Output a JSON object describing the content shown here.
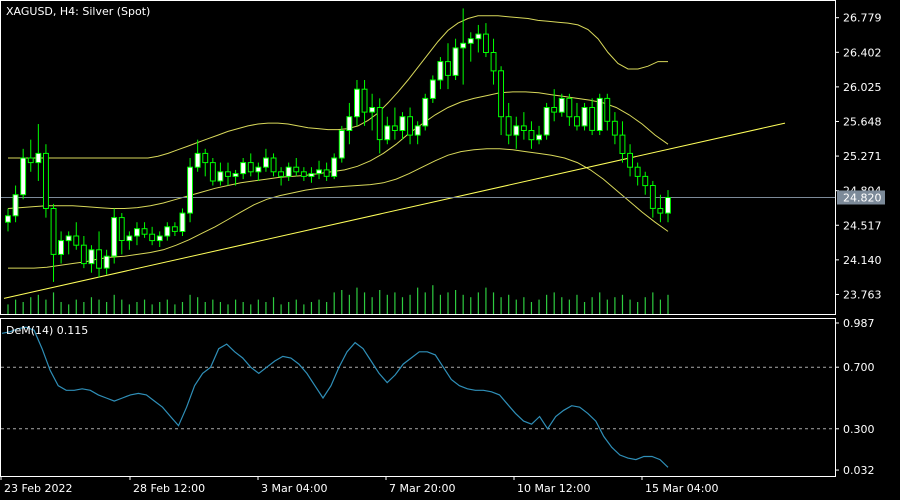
{
  "colors": {
    "background": "#000000",
    "frame": "#ffffff",
    "text": "#ffffff",
    "bull_candle": "#ffffff",
    "candle_wick": "#00ff00",
    "bands": "#d8d85a",
    "trendline": "#ffff5a",
    "volume": "#2ecc40",
    "dem_line": "#2f8fb8",
    "current_price_line": "#7c8a99",
    "current_price_label_bg": "#7c8a99",
    "dashed_level": "#aaaaaa"
  },
  "header": {
    "symbol_label": "XAGUSD, H4:  Silver (Spot)"
  },
  "chart_data": [
    {
      "type": "candlestick",
      "title": "XAGUSD, H4:  Silver (Spot)",
      "y_ticks": [
        "26.779",
        "26.402",
        "26.025",
        "25.648",
        "25.271",
        "24.894",
        "24.517",
        "24.140",
        "23.763"
      ],
      "ylim": [
        23.55,
        26.95
      ],
      "x_ticks": [
        "23 Feb 2022",
        "28 Feb 12:00",
        "3 Mar 04:00",
        "7 Mar 20:00",
        "10 Mar 12:00",
        "15 Mar 04:00"
      ],
      "current_price": "24.820",
      "indicators": [
        "Bollinger Bands",
        "Trendline",
        "Volume"
      ],
      "candles": [
        {
          "o": 24.55,
          "h": 24.7,
          "l": 24.45,
          "c": 24.62
        },
        {
          "o": 24.62,
          "h": 24.95,
          "l": 24.55,
          "c": 24.85
        },
        {
          "o": 24.85,
          "h": 25.35,
          "l": 24.8,
          "c": 25.25
        },
        {
          "o": 25.25,
          "h": 25.45,
          "l": 25.1,
          "c": 25.2
        },
        {
          "o": 25.2,
          "h": 25.62,
          "l": 25.0,
          "c": 25.3
        },
        {
          "o": 25.3,
          "h": 25.4,
          "l": 24.6,
          "c": 24.7
        },
        {
          "o": 24.7,
          "h": 24.75,
          "l": 23.9,
          "c": 24.2
        },
        {
          "o": 24.2,
          "h": 24.45,
          "l": 24.1,
          "c": 24.35
        },
        {
          "o": 24.35,
          "h": 24.45,
          "l": 24.2,
          "c": 24.4
        },
        {
          "o": 24.4,
          "h": 24.55,
          "l": 24.25,
          "c": 24.3
        },
        {
          "o": 24.3,
          "h": 24.4,
          "l": 24.05,
          "c": 24.1
        },
        {
          "o": 24.1,
          "h": 24.3,
          "l": 24.0,
          "c": 24.25
        },
        {
          "o": 24.25,
          "h": 24.45,
          "l": 23.95,
          "c": 24.05
        },
        {
          "o": 24.05,
          "h": 24.25,
          "l": 23.98,
          "c": 24.18
        },
        {
          "o": 24.18,
          "h": 24.7,
          "l": 24.1,
          "c": 24.6
        },
        {
          "o": 24.6,
          "h": 24.65,
          "l": 24.2,
          "c": 24.35
        },
        {
          "o": 24.35,
          "h": 24.45,
          "l": 24.25,
          "c": 24.4
        },
        {
          "o": 24.4,
          "h": 24.55,
          "l": 24.3,
          "c": 24.48
        },
        {
          "o": 24.48,
          "h": 24.55,
          "l": 24.38,
          "c": 24.42
        },
        {
          "o": 24.42,
          "h": 24.5,
          "l": 24.3,
          "c": 24.35
        },
        {
          "o": 24.35,
          "h": 24.45,
          "l": 24.28,
          "c": 24.4
        },
        {
          "o": 24.4,
          "h": 24.55,
          "l": 24.35,
          "c": 24.5
        },
        {
          "o": 24.5,
          "h": 24.55,
          "l": 24.4,
          "c": 24.45
        },
        {
          "o": 24.45,
          "h": 24.7,
          "l": 24.4,
          "c": 24.65
        },
        {
          "o": 24.65,
          "h": 25.25,
          "l": 24.55,
          "c": 25.15
        },
        {
          "o": 25.15,
          "h": 25.45,
          "l": 25.1,
          "c": 25.3
        },
        {
          "o": 25.3,
          "h": 25.35,
          "l": 25.05,
          "c": 25.2
        },
        {
          "o": 25.2,
          "h": 25.25,
          "l": 24.95,
          "c": 25.0
        },
        {
          "o": 25.0,
          "h": 25.2,
          "l": 24.95,
          "c": 25.1
        },
        {
          "o": 25.1,
          "h": 25.2,
          "l": 24.95,
          "c": 25.05
        },
        {
          "o": 25.05,
          "h": 25.12,
          "l": 24.95,
          "c": 25.08
        },
        {
          "o": 25.08,
          "h": 25.25,
          "l": 25.02,
          "c": 25.2
        },
        {
          "o": 25.2,
          "h": 25.3,
          "l": 25.05,
          "c": 25.1
        },
        {
          "o": 25.1,
          "h": 25.2,
          "l": 25.0,
          "c": 25.15
        },
        {
          "o": 25.15,
          "h": 25.35,
          "l": 25.1,
          "c": 25.25
        },
        {
          "o": 25.25,
          "h": 25.3,
          "l": 25.05,
          "c": 25.1
        },
        {
          "o": 25.1,
          "h": 25.15,
          "l": 24.95,
          "c": 25.05
        },
        {
          "o": 25.05,
          "h": 25.2,
          "l": 25.0,
          "c": 25.15
        },
        {
          "o": 25.15,
          "h": 25.25,
          "l": 25.05,
          "c": 25.1
        },
        {
          "o": 25.1,
          "h": 25.15,
          "l": 25.0,
          "c": 25.05
        },
        {
          "o": 25.05,
          "h": 25.15,
          "l": 24.98,
          "c": 25.08
        },
        {
          "o": 25.08,
          "h": 25.22,
          "l": 25.02,
          "c": 25.12
        },
        {
          "o": 25.12,
          "h": 25.2,
          "l": 25.0,
          "c": 25.05
        },
        {
          "o": 25.05,
          "h": 25.3,
          "l": 25.02,
          "c": 25.25
        },
        {
          "o": 25.25,
          "h": 25.6,
          "l": 25.2,
          "c": 25.55
        },
        {
          "o": 25.55,
          "h": 25.85,
          "l": 25.4,
          "c": 25.7
        },
        {
          "o": 25.7,
          "h": 26.1,
          "l": 25.6,
          "c": 26.0
        },
        {
          "o": 26.0,
          "h": 26.1,
          "l": 25.6,
          "c": 25.75
        },
        {
          "o": 25.75,
          "h": 25.95,
          "l": 25.55,
          "c": 25.8
        },
        {
          "o": 25.8,
          "h": 25.9,
          "l": 25.3,
          "c": 25.45
        },
        {
          "o": 25.45,
          "h": 25.7,
          "l": 25.4,
          "c": 25.6
        },
        {
          "o": 25.6,
          "h": 25.8,
          "l": 25.45,
          "c": 25.55
        },
        {
          "o": 25.55,
          "h": 25.75,
          "l": 25.45,
          "c": 25.7
        },
        {
          "o": 25.7,
          "h": 25.8,
          "l": 25.4,
          "c": 25.5
        },
        {
          "o": 25.5,
          "h": 25.65,
          "l": 25.4,
          "c": 25.6
        },
        {
          "o": 25.6,
          "h": 25.95,
          "l": 25.55,
          "c": 25.9
        },
        {
          "o": 25.9,
          "h": 26.15,
          "l": 25.85,
          "c": 26.1
        },
        {
          "o": 26.1,
          "h": 26.35,
          "l": 26.0,
          "c": 26.3
        },
        {
          "o": 26.3,
          "h": 26.5,
          "l": 26.0,
          "c": 26.15
        },
        {
          "o": 26.15,
          "h": 26.55,
          "l": 26.1,
          "c": 26.45
        },
        {
          "o": 26.45,
          "h": 26.88,
          "l": 26.05,
          "c": 26.5
        },
        {
          "o": 26.5,
          "h": 26.62,
          "l": 26.3,
          "c": 26.55
        },
        {
          "o": 26.55,
          "h": 26.7,
          "l": 26.4,
          "c": 26.6
        },
        {
          "o": 26.6,
          "h": 26.72,
          "l": 26.35,
          "c": 26.4
        },
        {
          "o": 26.4,
          "h": 26.55,
          "l": 26.05,
          "c": 26.2
        },
        {
          "o": 26.2,
          "h": 26.25,
          "l": 25.5,
          "c": 25.7
        },
        {
          "o": 25.7,
          "h": 25.85,
          "l": 25.4,
          "c": 25.5
        },
        {
          "o": 25.5,
          "h": 25.7,
          "l": 25.35,
          "c": 25.6
        },
        {
          "o": 25.6,
          "h": 25.75,
          "l": 25.45,
          "c": 25.55
        },
        {
          "o": 25.55,
          "h": 25.65,
          "l": 25.35,
          "c": 25.45
        },
        {
          "o": 25.45,
          "h": 25.6,
          "l": 25.4,
          "c": 25.5
        },
        {
          "o": 25.5,
          "h": 25.85,
          "l": 25.45,
          "c": 25.8
        },
        {
          "o": 25.8,
          "h": 26.0,
          "l": 25.65,
          "c": 25.75
        },
        {
          "o": 25.75,
          "h": 25.95,
          "l": 25.7,
          "c": 25.9
        },
        {
          "o": 25.9,
          "h": 25.95,
          "l": 25.6,
          "c": 25.7
        },
        {
          "o": 25.7,
          "h": 25.85,
          "l": 25.55,
          "c": 25.6
        },
        {
          "o": 25.6,
          "h": 25.85,
          "l": 25.55,
          "c": 25.8
        },
        {
          "o": 25.8,
          "h": 25.9,
          "l": 25.5,
          "c": 25.55
        },
        {
          "o": 25.55,
          "h": 25.95,
          "l": 25.5,
          "c": 25.9
        },
        {
          "o": 25.9,
          "h": 25.95,
          "l": 25.55,
          "c": 25.65
        },
        {
          "o": 25.65,
          "h": 25.75,
          "l": 25.4,
          "c": 25.5
        },
        {
          "o": 25.5,
          "h": 25.65,
          "l": 25.2,
          "c": 25.3
        },
        {
          "o": 25.3,
          "h": 25.4,
          "l": 25.05,
          "c": 25.15
        },
        {
          "o": 25.15,
          "h": 25.2,
          "l": 24.95,
          "c": 25.05
        },
        {
          "o": 25.05,
          "h": 25.1,
          "l": 24.85,
          "c": 24.95
        },
        {
          "o": 24.95,
          "h": 25.0,
          "l": 24.6,
          "c": 24.7
        },
        {
          "o": 24.7,
          "h": 24.85,
          "l": 24.55,
          "c": 24.65
        },
        {
          "o": 24.65,
          "h": 24.9,
          "l": 24.55,
          "c": 24.82
        }
      ],
      "volume": [
        4,
        6,
        5,
        7,
        8,
        6,
        9,
        5,
        4,
        6,
        5,
        7,
        6,
        5,
        8,
        6,
        4,
        5,
        6,
        4,
        5,
        6,
        4,
        5,
        8,
        7,
        5,
        6,
        5,
        4,
        6,
        5,
        4,
        6,
        5,
        7,
        4,
        5,
        6,
        4,
        5,
        6,
        5,
        9,
        10,
        8,
        11,
        9,
        7,
        10,
        8,
        9,
        7,
        8,
        11,
        9,
        12,
        8,
        9,
        10,
        8,
        7,
        9,
        11,
        9,
        7,
        8,
        6,
        7,
        5,
        6,
        8,
        9,
        7,
        6,
        8,
        5,
        7,
        9,
        6,
        7,
        8,
        6,
        5,
        7,
        9,
        6,
        8,
        5
      ],
      "bands": {
        "upper": [
          25.25,
          25.25,
          25.25,
          25.25,
          25.25,
          25.25,
          25.25,
          25.25,
          25.25,
          25.25,
          25.25,
          25.25,
          25.25,
          25.25,
          25.25,
          25.27,
          25.3,
          25.34,
          25.38,
          25.42,
          25.46,
          25.5,
          25.54,
          25.57,
          25.6,
          25.62,
          25.63,
          25.63,
          25.62,
          25.6,
          25.58,
          25.57,
          25.56,
          25.56,
          25.57,
          25.6,
          25.66,
          25.74,
          25.85,
          25.97,
          26.1,
          26.24,
          26.38,
          26.52,
          26.64,
          26.72,
          26.77,
          26.8,
          26.8,
          26.8,
          26.79,
          26.78,
          26.77,
          26.75,
          26.74,
          26.73,
          26.72,
          26.7,
          26.65,
          26.55,
          26.4,
          26.28,
          26.22,
          26.22,
          26.25,
          26.3,
          26.3
        ],
        "middle": [
          24.7,
          24.71,
          24.72,
          24.73,
          24.73,
          24.73,
          24.72,
          24.71,
          24.7,
          24.7,
          24.71,
          24.73,
          24.76,
          24.8,
          24.84,
          24.88,
          24.92,
          24.95,
          24.98,
          25.0,
          25.02,
          25.04,
          25.05,
          25.06,
          25.08,
          25.1,
          25.12,
          25.16,
          25.22,
          25.3,
          25.4,
          25.52,
          25.62,
          25.72,
          25.8,
          25.86,
          25.9,
          25.93,
          25.96,
          25.97,
          25.97,
          25.96,
          25.94,
          25.92,
          25.9,
          25.88,
          25.85,
          25.8,
          25.72,
          25.62,
          25.5,
          25.4
        ],
        "lower": [
          24.05,
          24.05,
          24.05,
          24.06,
          24.08,
          24.1,
          24.12,
          24.15,
          24.17,
          24.18,
          24.2,
          24.22,
          24.25,
          24.3,
          24.36,
          24.43,
          24.5,
          24.58,
          24.66,
          24.74,
          24.8,
          24.84,
          24.87,
          24.9,
          24.92,
          24.93,
          24.94,
          24.95,
          24.96,
          24.98,
          25.02,
          25.08,
          25.15,
          25.22,
          25.28,
          25.32,
          25.34,
          25.35,
          25.35,
          25.34,
          25.32,
          25.3,
          25.28,
          25.25,
          25.2,
          25.12,
          25.02,
          24.9,
          24.78,
          24.66,
          24.55,
          24.45
        ]
      }
    },
    {
      "type": "line",
      "title": "DeM(14) 0.115",
      "y_ticks": [
        "0.987",
        "0.700",
        "0.300",
        "0.032"
      ],
      "ylim": [
        0.0,
        1.0
      ],
      "dashed_levels": [
        0.7,
        0.3
      ],
      "series": [
        {
          "values": [
            0.92,
            0.93,
            0.95,
            0.96,
            0.94,
            0.82,
            0.68,
            0.58,
            0.55,
            0.55,
            0.56,
            0.55,
            0.52,
            0.5,
            0.48,
            0.5,
            0.52,
            0.53,
            0.52,
            0.48,
            0.44,
            0.38,
            0.32,
            0.44,
            0.58,
            0.66,
            0.7,
            0.82,
            0.85,
            0.8,
            0.76,
            0.7,
            0.66,
            0.7,
            0.74,
            0.77,
            0.76,
            0.72,
            0.66,
            0.58,
            0.5,
            0.58,
            0.7,
            0.8,
            0.86,
            0.82,
            0.74,
            0.66,
            0.6,
            0.65,
            0.72,
            0.76,
            0.8,
            0.8,
            0.78,
            0.7,
            0.62,
            0.58,
            0.56,
            0.55,
            0.55,
            0.54,
            0.52,
            0.46,
            0.4,
            0.35,
            0.33,
            0.38,
            0.3,
            0.38,
            0.42,
            0.45,
            0.44,
            0.4,
            0.35,
            0.25,
            0.18,
            0.13,
            0.11,
            0.1,
            0.12,
            0.12,
            0.1,
            0.05
          ]
        }
      ]
    }
  ]
}
